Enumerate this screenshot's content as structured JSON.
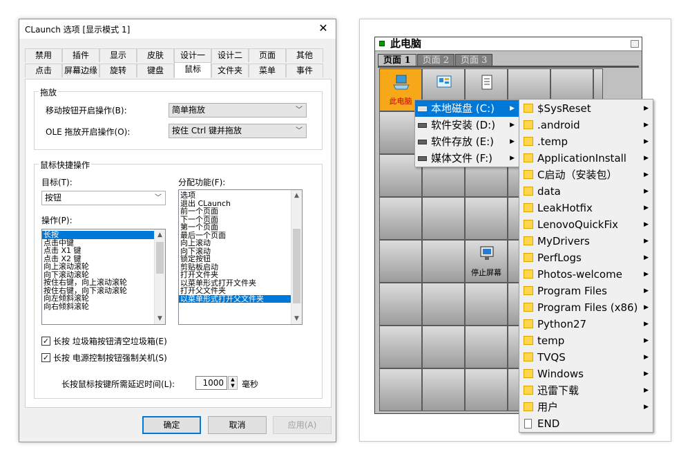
{
  "dialog": {
    "title": "CLaunch 选项 [显示模式 1]",
    "close": "✕",
    "tabs_row1": [
      "禁用",
      "插件",
      "显示",
      "皮肤",
      "设计一",
      "设计二",
      "页面",
      "其他"
    ],
    "tabs_row2": [
      "点击",
      "屏幕边缘",
      "旋转",
      "键盘",
      "鼠标",
      "文件夹",
      "菜单",
      "事件"
    ],
    "active_tab": "鼠标",
    "drag_group": {
      "label": "拖放",
      "move_label": "移动按钮开启操作(B):",
      "move_value": "简单拖放",
      "ole_label": "OLE 拖放开启操作(O):",
      "ole_value": "按住 Ctrl 键并拖放"
    },
    "shortcut_group": {
      "label": "鼠标快捷操作",
      "target_label": "目标(T):",
      "target_value": "按钮",
      "action_label": "操作(P):",
      "actions": [
        "长按",
        "点击中键",
        "点击 X1 键",
        "点击 X2 键",
        "向上滚动滚轮",
        "向下滚动滚轮",
        "按住右键，向上滚动滚轮",
        "按住右键，向下滚动滚轮",
        "向左倾斜滚轮",
        "向右倾斜滚轮"
      ],
      "actions_selected": 0,
      "function_label": "分配功能(F):",
      "functions": [
        "选项",
        "退出 CLaunch",
        "前一个页面",
        "下一个页面",
        "第一个页面",
        "最后一个页面",
        "向上滚动",
        "向下滚动",
        "锁定按钮",
        "剪贴板启动",
        "打开文件夹",
        "以菜单形式打开文件夹",
        "打开父文件夹",
        "以菜单形式打开父文件夹"
      ],
      "functions_selected": 13
    },
    "check1": "长按 垃圾箱按钮清空垃圾箱(E)",
    "check2": "长按 电源控制按钮强制关机(S)",
    "check_mark": "✓",
    "delay_label": "长按鼠标按键所需延迟时间(L):",
    "delay_value": "1000",
    "delay_unit": "毫秒",
    "ok": "确定",
    "cancel": "取消",
    "apply": "应用(A)"
  },
  "launcher": {
    "title": "此电脑",
    "pages": [
      "页面 1",
      "页面 2",
      "页面 3"
    ],
    "active_page": "页面 1",
    "cell_thispc": "此电脑",
    "cell_screensaver": "停止屏幕",
    "drives": [
      {
        "label": "本地磁盘 (C:)",
        "highlight": true
      },
      {
        "label": "软件安装 (D:)",
        "highlight": false
      },
      {
        "label": "软件存放 (E:)",
        "highlight": false
      },
      {
        "label": "媒体文件 (F:)",
        "highlight": false
      }
    ],
    "folders": [
      "$SysReset",
      ".android",
      ".temp",
      "ApplicationInstall",
      "C启动（安装包）",
      "data",
      "LeakHotfix",
      "LenovoQuickFix",
      "MyDrivers",
      "PerfLogs",
      "Photos-welcome",
      "Program Files",
      "Program Files (x86)",
      "Python27",
      "temp",
      "TVQS",
      "Windows",
      "迅雷下载",
      "用户"
    ],
    "last_file": "END",
    "submenu_arrow": "▶"
  },
  "colors": {
    "selection": "#0078d7",
    "launcher_face": "#c0c0c0",
    "thispc_cell": "#f7a818",
    "folder_icon": "#ffd54a"
  }
}
